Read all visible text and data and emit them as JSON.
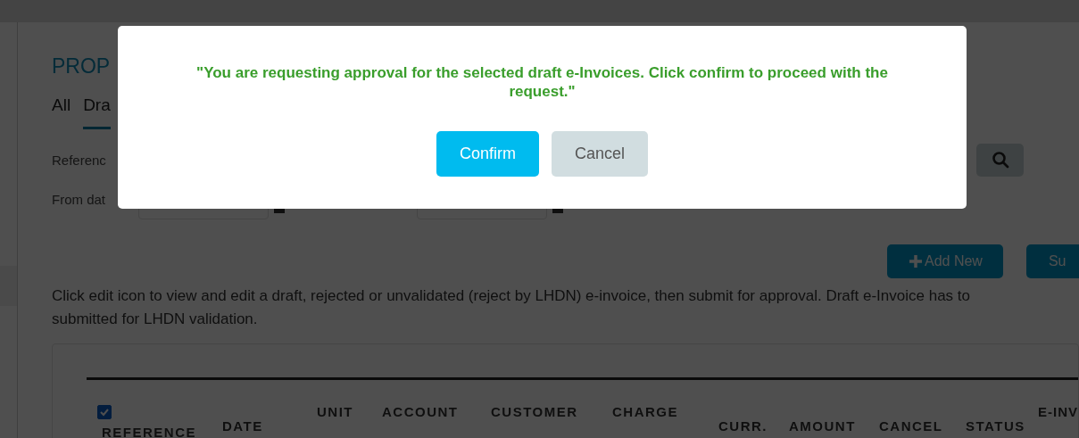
{
  "page": {
    "title": "PROP",
    "tabs": [
      {
        "label": "All",
        "selected": false
      },
      {
        "label": "Dra",
        "selected": true
      }
    ],
    "filters": {
      "reference_label": "Referenc",
      "from_date_label": "From dat"
    },
    "buttons": [
      "Add New",
      "Su"
    ],
    "note_lines": [
      "Click edit icon to view and edit a draft, rejected or unvalidated (reject by LHDN) e-invoice, then submit for approval. Draft e-Invoice has to",
      "submitted for LHDN validation."
    ],
    "table": {
      "select_all": {
        "checked": true
      },
      "columns": [
        "REFERENCE",
        "DATE",
        "UNIT",
        "ACCOUNT",
        "CUSTOMER",
        "CHARGE",
        "CURR.",
        "AMOUNT",
        "CANCEL",
        "STATUS",
        "E-INV"
      ]
    }
  },
  "dialog": {
    "message": "\"You are requesting approval for the selected draft e-Invoices. Click confirm to proceed with the request.\"",
    "buttons": [
      {
        "label": "Confirm",
        "kind": "primary"
      },
      {
        "label": "Cancel",
        "kind": "secondary"
      }
    ]
  }
}
